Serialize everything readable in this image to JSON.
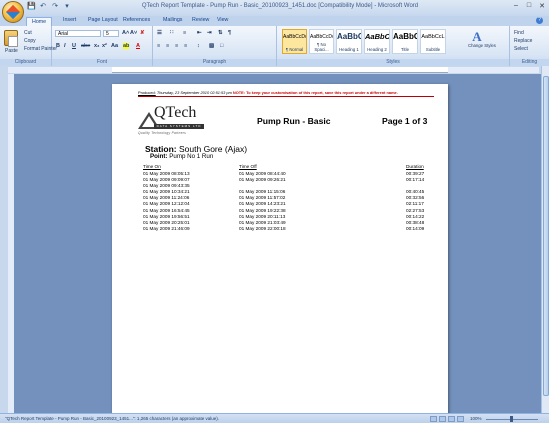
{
  "window": {
    "title": "QTech Report Template - Pump Run  -  Basic_20100923_1451.doc [Compatibility Mode]  -  Microsoft Word",
    "minimize": "–",
    "maximize": "□",
    "close": "✕"
  },
  "quick_access": {
    "save": "💾",
    "undo": "↶",
    "redo": "↷",
    "customize": "▾"
  },
  "tabs": [
    "Home",
    "Insert",
    "Page Layout",
    "References",
    "Mailings",
    "Review",
    "View"
  ],
  "active_tab": "Home",
  "help": "?",
  "ribbon": {
    "clipboard": {
      "label": "Clipboard",
      "paste": "Paste",
      "cut": "Cut",
      "copy": "Copy",
      "format_painter": "Format Painter"
    },
    "font": {
      "label": "Font",
      "font_name": "Arial",
      "font_size": "5",
      "bold": "B",
      "italic": "I",
      "underline": "U",
      "strike": "abe",
      "sub": "x₂",
      "sup": "x²",
      "case": "Aa",
      "grow": "A˄",
      "shrink": "A˅",
      "clear": "✘",
      "highlight": "ab",
      "color": "A"
    },
    "paragraph": {
      "label": "Paragraph",
      "bullets": "☰",
      "numbering": "∷",
      "multilevel": "≡",
      "decrease": "⇤",
      "increase": "⇥",
      "sort": "⇅",
      "show": "¶",
      "align_left": "≡",
      "center": "≡",
      "align_right": "≡",
      "justify": "≡",
      "spacing": "↕",
      "shading": "▧",
      "borders": "□"
    },
    "styles": {
      "label": "Styles",
      "items": [
        {
          "sample": "AaBbCcDc",
          "name": "¶ Normal"
        },
        {
          "sample": "AaBbCcDc",
          "name": "¶ No Spaci..."
        },
        {
          "sample": "AaBbC",
          "name": "Heading 1"
        },
        {
          "sample": "AaBbCc",
          "name": "Heading 2"
        },
        {
          "sample": "AaBbC",
          "name": "Title"
        },
        {
          "sample": "AaBbCcL",
          "name": "Subtitle"
        }
      ],
      "change_styles": "Change Styles",
      "change_icon": "A"
    },
    "editing": {
      "label": "Editing",
      "find": "Find",
      "replace": "Replace",
      "select": "Select"
    }
  },
  "document": {
    "produced_label": "Produced:",
    "produced_value": "Thursday, 23 September 2010 02:51:53 pm",
    "note": "NOTE: To keep your customisation of this report, save this report under a different name.",
    "logo_word": "QTech",
    "logo_bar": "DATA SYSTEMS LTD",
    "logo_tagline": "Quality Technology Partners",
    "report_title": "Pump Run - Basic",
    "page_number": "Page 1 of 3",
    "station_label": "Station:",
    "station_value": "South Gore (Ajax)",
    "point_label": "Point:",
    "point_value": "Pump No 1 Run",
    "columns": [
      "Time On",
      "Time Off",
      "Duration"
    ],
    "rows": [
      [
        "01 May 2009 08:05:13",
        "01 May 2009 08:44:40",
        "00:39:27"
      ],
      [
        "01 May 2009 09:09:07",
        "01 May 2009 09:26:21",
        "00:17:14"
      ],
      [
        "01 May 2009 09:43:35",
        "",
        ""
      ],
      [
        "01 May 2009 10:34:21",
        "01 May 2009 11:15:06",
        "00:40:45"
      ],
      [
        "01 May 2009 11:24:06",
        "01 May 2009 11:57:02",
        "00:32:56"
      ],
      [
        "01 May 2009 12:12:04",
        "01 May 2009 14:23:21",
        "02:11:17"
      ],
      [
        "01 May 2009 16:54:45",
        "01 May 2009 19:22:38",
        "02:27:53"
      ],
      [
        "01 May 2009 19:56:51",
        "01 May 2009 20:11:13",
        "00:14:22"
      ],
      [
        "01 May 2009 20:25:01",
        "01 May 2009 21:03:49",
        "00:38:48"
      ],
      [
        "01 May 2009 21:46:09",
        "01 May 2009 22:00:18",
        "00:14:09"
      ]
    ]
  },
  "status_bar": {
    "text": "\"QTech Report Template - Pump Run  -  Basic_20100923_1451...\": 1,265 characters (an approximate value).",
    "zoom": "100%"
  },
  "colors": {
    "ribbon_bg": "#dae6f5",
    "doc_bg": "#7391bc",
    "note_red": "#cc0000",
    "title_blue": "#15428b"
  }
}
